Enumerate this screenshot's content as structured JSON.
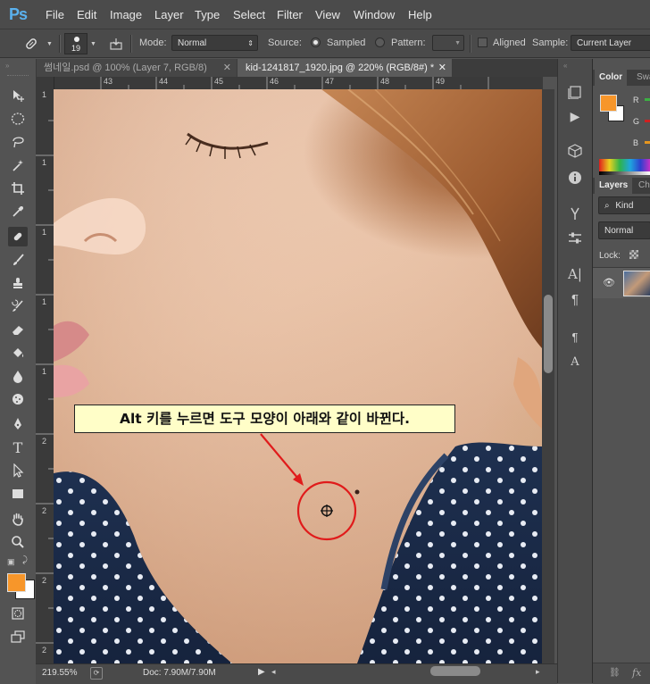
{
  "app": {
    "logo": "Ps"
  },
  "menu": [
    "File",
    "Edit",
    "Image",
    "Layer",
    "Type",
    "Select",
    "Filter",
    "View",
    "Window",
    "Help"
  ],
  "options": {
    "brush_size": "19",
    "mode_label": "Mode:",
    "mode_value": "Normal",
    "source_label": "Source:",
    "sampled_label": "Sampled",
    "pattern_label": "Pattern:",
    "aligned_label": "Aligned",
    "sample_label": "Sample:",
    "sample_value": "Current Layer"
  },
  "tabs": [
    {
      "label": "썸네일.psd @ 100% (Layer 7, RGB/8)",
      "active": false
    },
    {
      "label": "kid-1241817_1920.jpg @ 220% (RGB/8#) *",
      "active": true
    }
  ],
  "ruler_top": [
    "43",
    "44",
    "45",
    "46",
    "47",
    "48",
    "49"
  ],
  "ruler_left": [
    "1",
    "1",
    "1",
    "1",
    "1",
    "2",
    "2",
    "2",
    "2",
    "2"
  ],
  "annotation": {
    "text": "Alt 키를 누르면 도구 모양이 아래와 같이 바뀐다."
  },
  "status": {
    "zoom": "219.55%",
    "doc": "Doc: 7.90M/7.90M"
  },
  "color_panel": {
    "tabs": [
      "Color",
      "Swa"
    ],
    "channels": [
      "R",
      "G",
      "B"
    ],
    "foreground": "#f7962a",
    "background": "#ffffff"
  },
  "layers_panel": {
    "tabs": [
      "Layers",
      "Ch"
    ],
    "filter_kind": "Kind",
    "blend_mode": "Normal",
    "lock_label": "Lock:"
  },
  "colors": {
    "accent": "#5ab1ee",
    "highlight_circle": "#e01b1b",
    "foreground": "#f7962a"
  }
}
